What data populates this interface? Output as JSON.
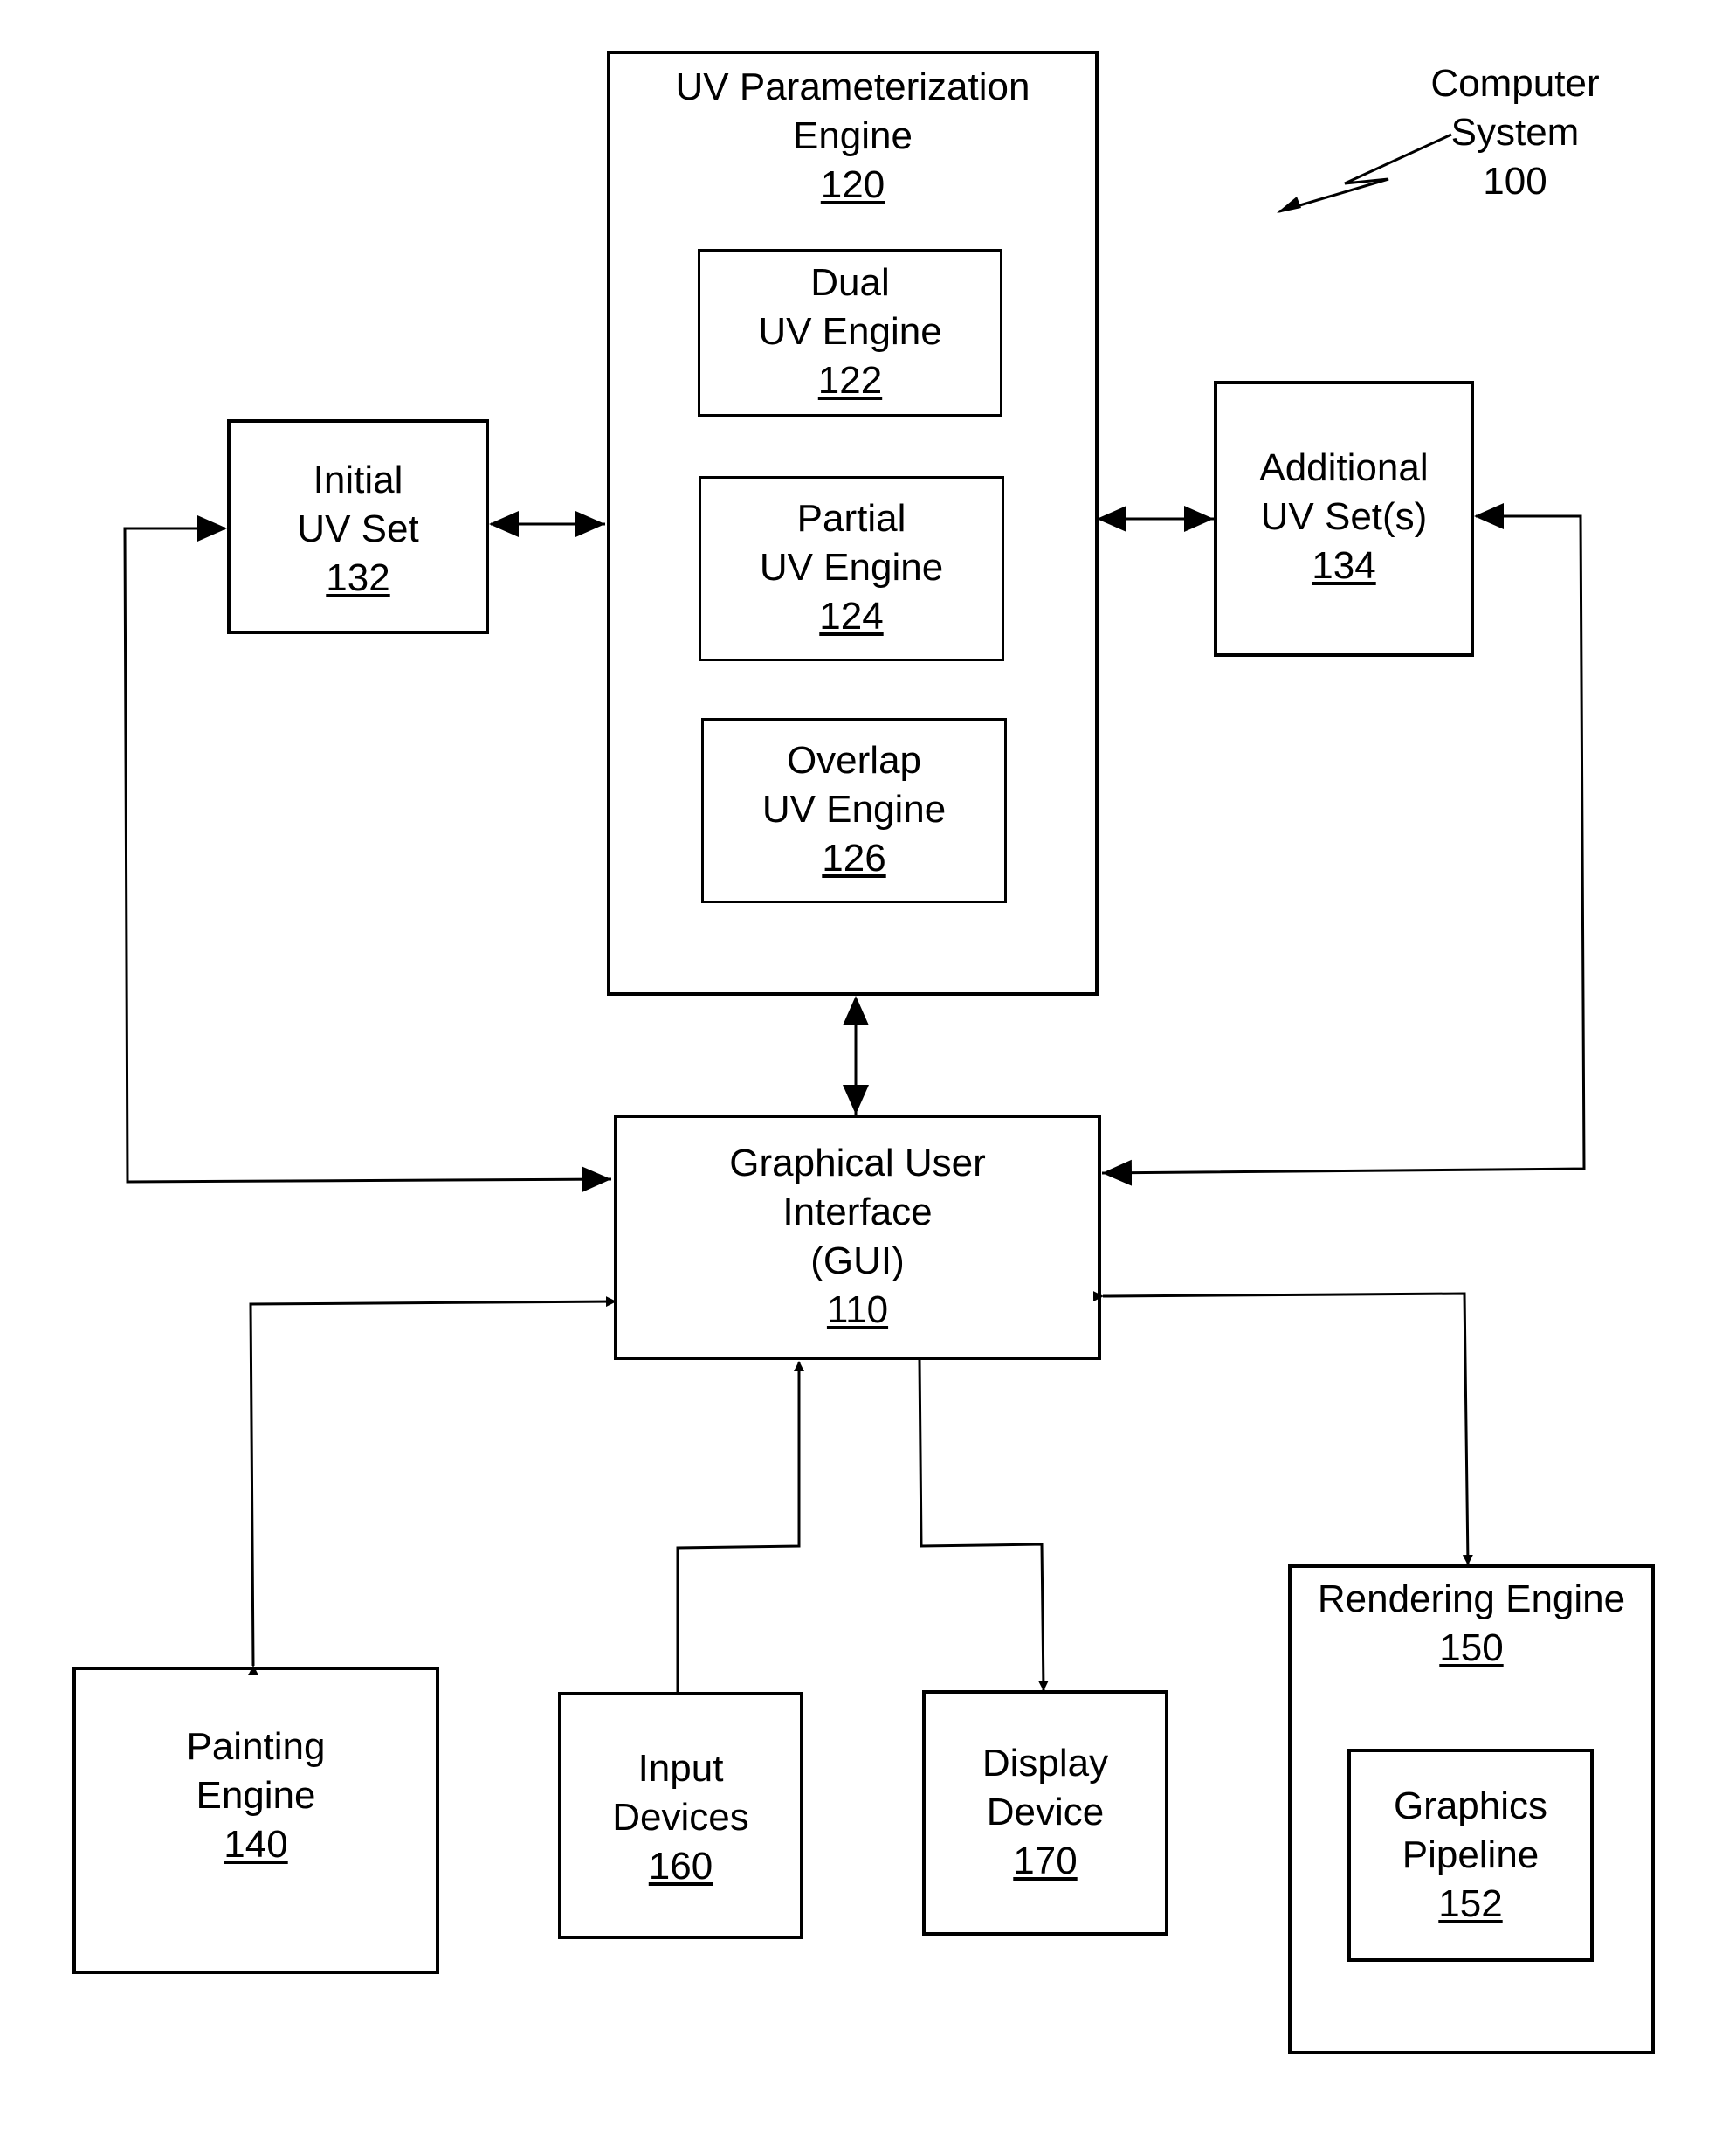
{
  "title": {
    "line1": "Computer",
    "line2": "System",
    "ref": "100"
  },
  "nodes": {
    "uv_param": {
      "line1": "UV Parameterization",
      "line2": "Engine",
      "ref": "120"
    },
    "dual": {
      "line1": "Dual",
      "line2": "UV Engine",
      "ref": "122"
    },
    "partial": {
      "line1": "Partial",
      "line2": "UV Engine",
      "ref": "124"
    },
    "overlap": {
      "line1": "Overlap",
      "line2": "UV Engine",
      "ref": "126"
    },
    "initial": {
      "line1": "Initial",
      "line2": "UV Set",
      "ref": "132"
    },
    "additional": {
      "line1": "Additional",
      "line2": "UV Set(s)",
      "ref": "134"
    },
    "gui": {
      "line1": "Graphical User",
      "line2": "Interface",
      "line3": "(GUI)",
      "ref": "110"
    },
    "painting": {
      "line1": "Painting",
      "line2": "Engine",
      "ref": "140"
    },
    "input": {
      "line1": "Input",
      "line2": "Devices",
      "ref": "160"
    },
    "display": {
      "line1": "Display",
      "line2": "Device",
      "ref": "170"
    },
    "rendering": {
      "line1": "Rendering Engine",
      "ref": "150"
    },
    "pipeline": {
      "line1": "Graphics",
      "line2": "Pipeline",
      "ref": "152"
    }
  },
  "edges": [
    {
      "from": "initial",
      "to": "uv_param",
      "type": "bidirectional"
    },
    {
      "from": "uv_param",
      "to": "additional",
      "type": "bidirectional"
    },
    {
      "from": "uv_param",
      "to": "gui",
      "type": "bidirectional"
    },
    {
      "from": "initial",
      "to": "gui",
      "type": "bidirectional"
    },
    {
      "from": "additional",
      "to": "gui",
      "type": "bidirectional"
    },
    {
      "from": "painting",
      "to": "gui",
      "type": "bidirectional"
    },
    {
      "from": "input",
      "to": "gui",
      "type": "directed"
    },
    {
      "from": "gui",
      "to": "display",
      "type": "directed"
    },
    {
      "from": "gui",
      "to": "rendering",
      "type": "bidirectional"
    }
  ]
}
